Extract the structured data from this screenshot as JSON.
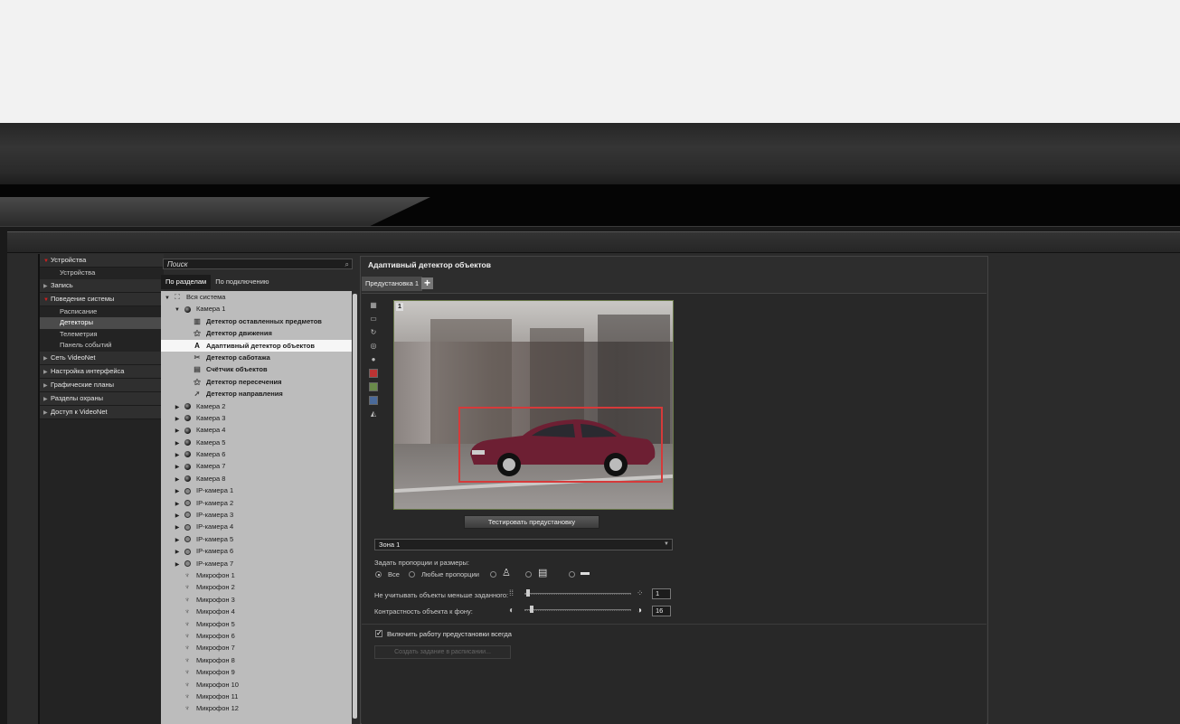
{
  "sidebar": {
    "sections": [
      {
        "label": "Устройства",
        "open": true,
        "items": [
          {
            "label": "Устройства",
            "active": false
          }
        ]
      },
      {
        "label": "Запись",
        "open": false,
        "items": []
      },
      {
        "label": "Поведение системы",
        "open": true,
        "items": [
          {
            "label": "Расписание",
            "active": false
          },
          {
            "label": "Детекторы",
            "active": true
          },
          {
            "label": "Телеметрия",
            "active": false
          },
          {
            "label": "Панель событий",
            "active": false
          }
        ]
      },
      {
        "label": "Сеть VideoNet",
        "open": false,
        "items": []
      },
      {
        "label": "Настройка интерфейса",
        "open": false,
        "items": []
      },
      {
        "label": "Графические планы",
        "open": false,
        "items": []
      },
      {
        "label": "Разделы охраны",
        "open": false,
        "items": []
      },
      {
        "label": "Доступ к VideoNet",
        "open": false,
        "items": []
      }
    ]
  },
  "tree_panel": {
    "search_placeholder": "Поиск",
    "tabs": [
      {
        "label": "По разделам",
        "active": true
      },
      {
        "label": "По подключению",
        "active": false
      }
    ],
    "rows": [
      {
        "indent": 0,
        "arrow": "open",
        "icon": "system-icon",
        "label": "Вся система",
        "bold": false,
        "selected": false
      },
      {
        "indent": 1,
        "arrow": "open",
        "icon": "camera-icon",
        "label": "Камера 1",
        "bold": false,
        "selected": false
      },
      {
        "indent": 2,
        "arrow": "none",
        "icon": "abandoned-object-icon",
        "label": "Детектор оставленных предметов",
        "bold": true,
        "selected": false
      },
      {
        "indent": 2,
        "arrow": "none",
        "icon": "motion-icon",
        "label": "Детектор движения",
        "bold": true,
        "selected": false
      },
      {
        "indent": 2,
        "arrow": "none",
        "icon": "adaptive-a-icon",
        "label": "Адаптивный детектор объектов",
        "bold": true,
        "selected": true
      },
      {
        "indent": 2,
        "arrow": "none",
        "icon": "sabotage-icon",
        "label": "Детектор саботажа",
        "bold": true,
        "selected": false
      },
      {
        "indent": 2,
        "arrow": "none",
        "icon": "counter-icon",
        "label": "Счётчик объектов",
        "bold": true,
        "selected": false
      },
      {
        "indent": 2,
        "arrow": "none",
        "icon": "crossing-icon",
        "label": "Детектор пересечения",
        "bold": true,
        "selected": false
      },
      {
        "indent": 2,
        "arrow": "none",
        "icon": "direction-icon",
        "label": "Детектор направления",
        "bold": true,
        "selected": false
      },
      {
        "indent": 1,
        "arrow": "closed",
        "icon": "camera-icon",
        "label": "Камера 2",
        "bold": false,
        "selected": false
      },
      {
        "indent": 1,
        "arrow": "closed",
        "icon": "camera-icon",
        "label": "Камера 3",
        "bold": false,
        "selected": false
      },
      {
        "indent": 1,
        "arrow": "closed",
        "icon": "camera-icon",
        "label": "Камера 4",
        "bold": false,
        "selected": false
      },
      {
        "indent": 1,
        "arrow": "closed",
        "icon": "camera-icon",
        "label": "Камера 5",
        "bold": false,
        "selected": false
      },
      {
        "indent": 1,
        "arrow": "closed",
        "icon": "camera-icon",
        "label": "Камера 6",
        "bold": false,
        "selected": false
      },
      {
        "indent": 1,
        "arrow": "closed",
        "icon": "camera-icon",
        "label": "Камера 7",
        "bold": false,
        "selected": false
      },
      {
        "indent": 1,
        "arrow": "closed",
        "icon": "camera-icon",
        "label": "Камера 8",
        "bold": false,
        "selected": false
      },
      {
        "indent": 1,
        "arrow": "closed",
        "icon": "ip-camera-icon",
        "label": "IP-камера 1",
        "bold": false,
        "selected": false
      },
      {
        "indent": 1,
        "arrow": "closed",
        "icon": "ip-camera-icon",
        "label": "IP-камера 2",
        "bold": false,
        "selected": false
      },
      {
        "indent": 1,
        "arrow": "closed",
        "icon": "ip-camera-icon",
        "label": "IP-камера 3",
        "bold": false,
        "selected": false
      },
      {
        "indent": 1,
        "arrow": "closed",
        "icon": "ip-camera-icon",
        "label": "IP-камера 4",
        "bold": false,
        "selected": false
      },
      {
        "indent": 1,
        "arrow": "closed",
        "icon": "ip-camera-icon",
        "label": "IP-камера 5",
        "bold": false,
        "selected": false
      },
      {
        "indent": 1,
        "arrow": "closed",
        "icon": "ip-camera-icon",
        "label": "IP-камера 6",
        "bold": false,
        "selected": false
      },
      {
        "indent": 1,
        "arrow": "closed",
        "icon": "ip-camera-icon",
        "label": "IP-камера 7",
        "bold": false,
        "selected": false
      },
      {
        "indent": 1,
        "arrow": "none",
        "icon": "microphone-icon",
        "label": "Микрофон 1",
        "bold": false,
        "selected": false
      },
      {
        "indent": 1,
        "arrow": "none",
        "icon": "microphone-icon",
        "label": "Микрофон 2",
        "bold": false,
        "selected": false
      },
      {
        "indent": 1,
        "arrow": "none",
        "icon": "microphone-icon",
        "label": "Микрофон 3",
        "bold": false,
        "selected": false
      },
      {
        "indent": 1,
        "arrow": "none",
        "icon": "microphone-icon",
        "label": "Микрофон 4",
        "bold": false,
        "selected": false
      },
      {
        "indent": 1,
        "arrow": "none",
        "icon": "microphone-icon",
        "label": "Микрофон 5",
        "bold": false,
        "selected": false
      },
      {
        "indent": 1,
        "arrow": "none",
        "icon": "microphone-icon",
        "label": "Микрофон 6",
        "bold": false,
        "selected": false
      },
      {
        "indent": 1,
        "arrow": "none",
        "icon": "microphone-icon",
        "label": "Микрофон 7",
        "bold": false,
        "selected": false
      },
      {
        "indent": 1,
        "arrow": "none",
        "icon": "microphone-icon",
        "label": "Микрофон 8",
        "bold": false,
        "selected": false
      },
      {
        "indent": 1,
        "arrow": "none",
        "icon": "microphone-icon",
        "label": "Микрофон 9",
        "bold": false,
        "selected": false
      },
      {
        "indent": 1,
        "arrow": "none",
        "icon": "microphone-icon",
        "label": "Микрофон 10",
        "bold": false,
        "selected": false
      },
      {
        "indent": 1,
        "arrow": "none",
        "icon": "microphone-icon",
        "label": "Микрофон 11",
        "bold": false,
        "selected": false
      },
      {
        "indent": 1,
        "arrow": "none",
        "icon": "microphone-icon",
        "label": "Микрофон 12",
        "bold": false,
        "selected": false
      }
    ]
  },
  "main": {
    "title": "Адаптивный детектор объектов",
    "preset_tab": "Предустановка 1",
    "add_preset": "+",
    "video_badge": "1",
    "test_button": "Тестировать предустановку",
    "zone_select": "Зона 1",
    "proportions_label": "Задать пропорции и размеры:",
    "option_all": "Все",
    "option_any": "Любые пропорции",
    "ignore_label": "Не учитывать объекты меньше заданного:",
    "ignore_value": "1",
    "ignore_level": 0.02,
    "contrast_label": "Контрастность объекта к фону:",
    "contrast_value": "16",
    "contrast_level": 0.05,
    "always_checkbox": "Включить работу предустановки всегда",
    "always_checked": true,
    "schedule_button": "Создать задание в расписании..."
  },
  "colors": {
    "detect_box": "#d63a3a",
    "sidebar_open_triangle": "#d02020",
    "selected_row": "#f6f6f6"
  }
}
